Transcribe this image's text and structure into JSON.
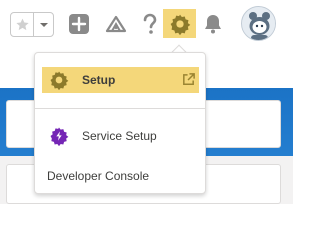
{
  "header": {
    "icons": [
      "star-icon",
      "chevron-down-icon",
      "add-icon",
      "trailhead-icon",
      "help-icon",
      "gear-icon",
      "bell-icon",
      "avatar"
    ]
  },
  "menu": {
    "setup_label": "Setup",
    "service_setup_label": "Service Setup",
    "developer_console_label": "Developer Console"
  },
  "colors": {
    "highlight": "#f4d77a",
    "setup_gear": "#8c7a2b",
    "service_gear": "#7526b5",
    "icon_gray": "#8a8a8a",
    "brand_blue": "#1b73c6"
  }
}
